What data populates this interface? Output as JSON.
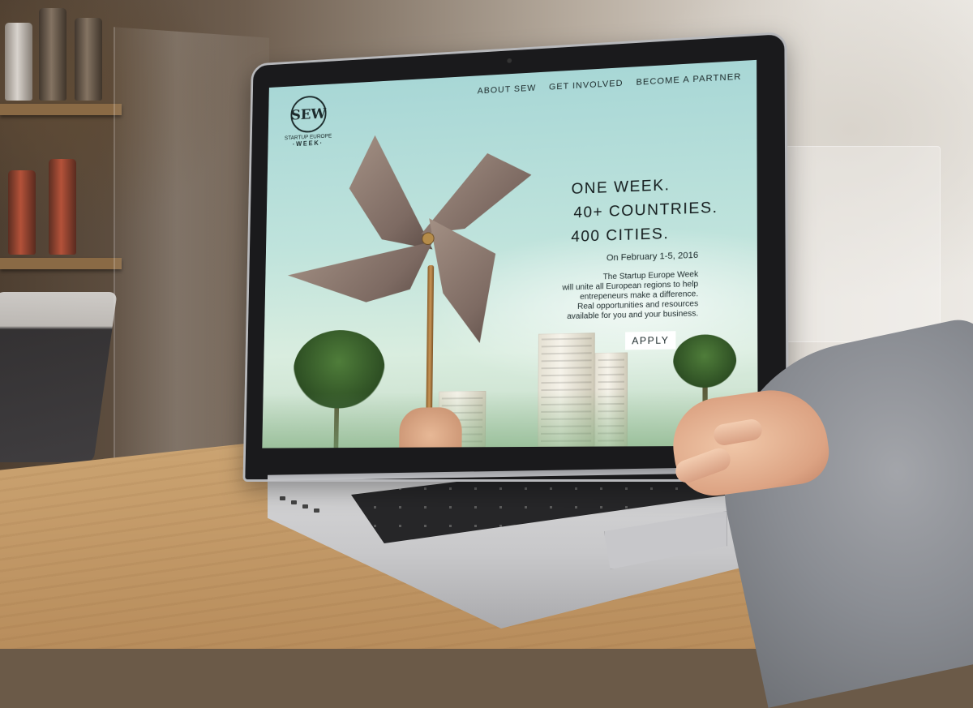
{
  "nav": {
    "items": [
      {
        "label": "ABOUT SEW"
      },
      {
        "label": "GET INVOLVED"
      },
      {
        "label": "BECOME A PARTNER"
      }
    ]
  },
  "logo": {
    "monogram": "SEW",
    "line1": "STARTUP EUROPE",
    "line2": "·WEEK·"
  },
  "hero": {
    "line1": "ONE WEEK.",
    "line2": "40+ COUNTRIES.",
    "line3": "400 CITIES.",
    "date": "On February 1-5, 2016",
    "description_lines": [
      "The Startup Europe Week",
      "will unite all European regions to help",
      "entrepeneurs make a difference.",
      "Real opportunities and resources",
      "available for you and your business."
    ],
    "apply_label": "APPLY"
  },
  "colors": {
    "sky": "#bfe3dc",
    "text": "#1c2a2b",
    "button_bg": "#ffffff"
  }
}
